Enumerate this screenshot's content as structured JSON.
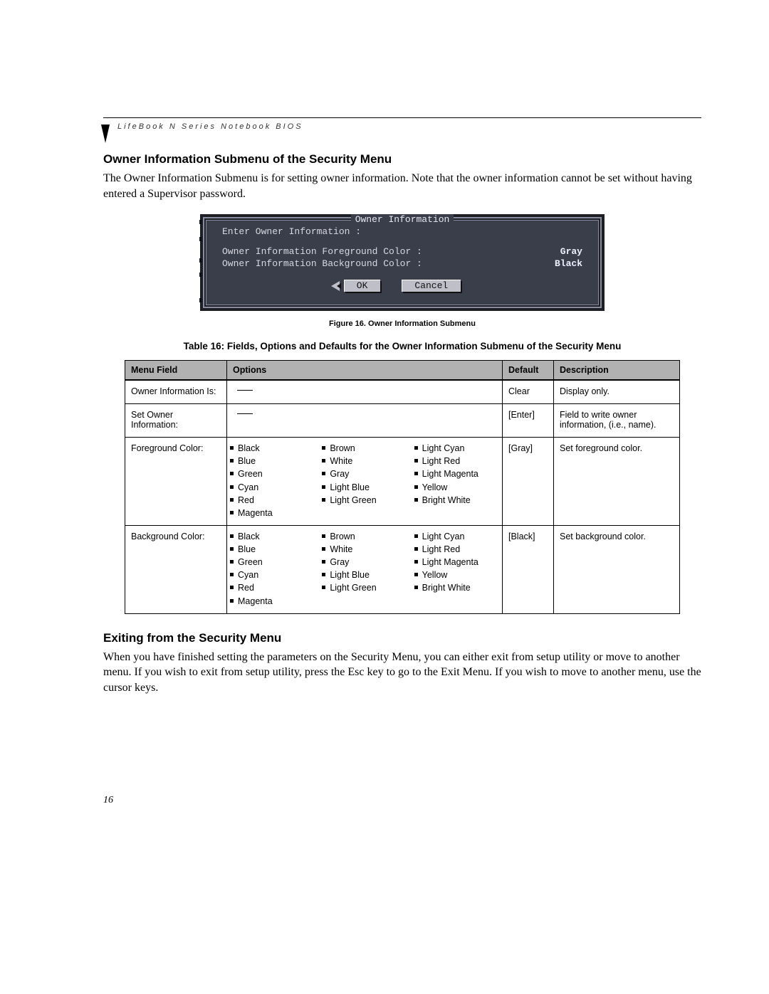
{
  "header": {
    "text": "LifeBook N Series Notebook BIOS"
  },
  "section1": {
    "heading": "Owner Information Submenu of the Security Menu",
    "paragraph": "The Owner Information Submenu is for setting owner information. Note that the owner information cannot be set without having entered a Supervisor password."
  },
  "bios": {
    "title": "Owner Information",
    "enter_label": "Enter Owner Information :",
    "fg_label": "Owner Information Foreground Color :",
    "fg_value": "Gray",
    "bg_label": "Owner Information Background Color :",
    "bg_value": "Black",
    "ok": "OK",
    "cancel": "Cancel"
  },
  "figcaption": "Figure 16.  Owner Information Submenu",
  "tablecaption": "Table 16: Fields, Options and Defaults for the Owner Information Submenu of the Security Menu",
  "table": {
    "headers": {
      "field": "Menu Field",
      "options": "Options",
      "default": "Default",
      "desc": "Description"
    },
    "rows": [
      {
        "field": "Owner Information Is:",
        "options_type": "dash",
        "options": [],
        "default": "Clear",
        "desc": "Display only."
      },
      {
        "field": "Set Owner Information:",
        "options_type": "dash",
        "options": [],
        "default": "[Enter]",
        "desc": "Field to write owner information, (i.e., name)."
      },
      {
        "field": "Foreground Color:",
        "options_type": "list",
        "options": [
          [
            "Black",
            "Blue",
            "Green",
            "Cyan",
            "Red",
            "Magenta"
          ],
          [
            "Brown",
            "White",
            "Gray",
            "Light Blue",
            "Light Green"
          ],
          [
            "Light Cyan",
            "Light Red",
            "Light Magenta",
            "Yellow",
            "Bright White"
          ]
        ],
        "default": "[Gray]",
        "desc": "Set foreground color."
      },
      {
        "field": "Background Color:",
        "options_type": "list",
        "options": [
          [
            "Black",
            "Blue",
            "Green",
            "Cyan",
            "Red",
            "Magenta"
          ],
          [
            "Brown",
            "White",
            "Gray",
            "Light Blue",
            "Light Green"
          ],
          [
            "Light Cyan",
            "Light Red",
            "Light Magenta",
            "Yellow",
            "Bright White"
          ]
        ],
        "default": "[Black]",
        "desc": "Set background color."
      }
    ]
  },
  "section2": {
    "heading": "Exiting from the Security Menu",
    "paragraph": "When you have finished setting the parameters on the Security Menu, you can either exit from setup utility or move to another menu. If you wish to exit from setup utility, press the Esc key to go to the Exit Menu. If you wish to move to another menu, use the cursor keys."
  },
  "pagenum": "16"
}
